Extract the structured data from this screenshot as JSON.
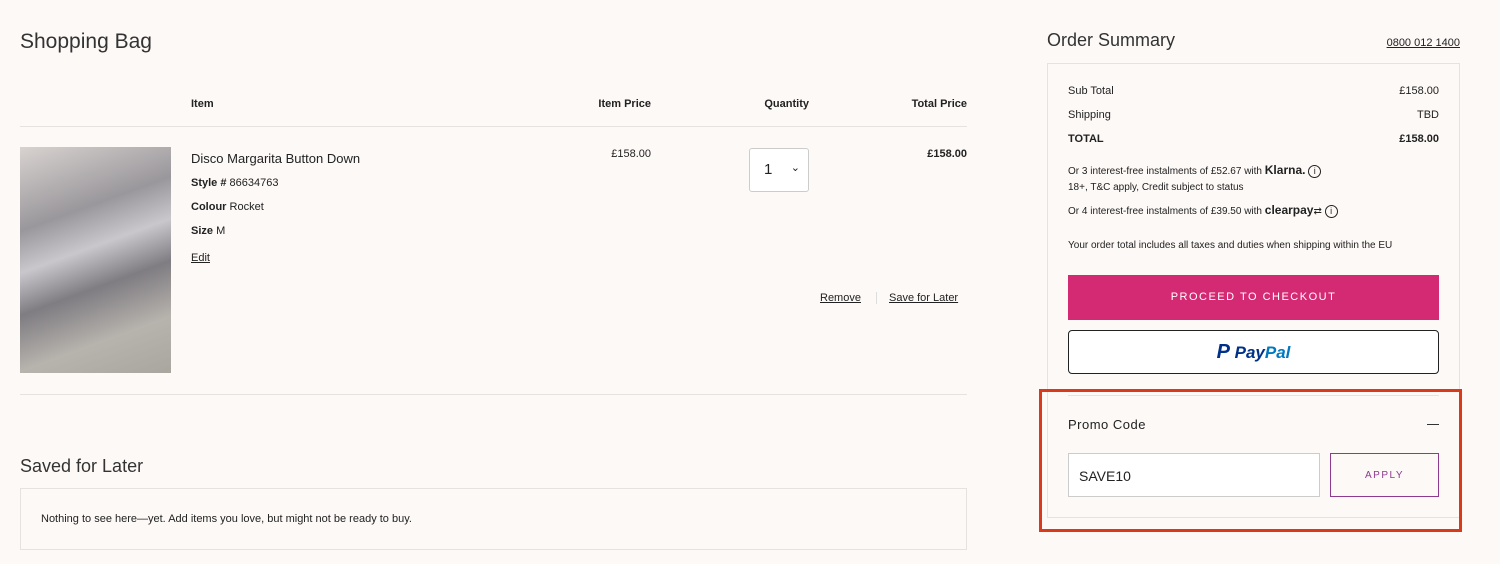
{
  "bag": {
    "title": "Shopping Bag",
    "headers": {
      "item": "Item",
      "item_price": "Item Price",
      "quantity": "Quantity",
      "total_price": "Total Price"
    },
    "item": {
      "name": "Disco Margarita Button Down",
      "style_label": "Style #",
      "style": "86634763",
      "colour_label": "Colour",
      "colour": "Rocket",
      "size_label": "Size",
      "size": "M",
      "edit": "Edit",
      "price": "£158.00",
      "quantity": "1",
      "total": "£158.00",
      "remove": "Remove",
      "save_for_later": "Save for Later"
    }
  },
  "saved": {
    "title": "Saved for Later",
    "empty": "Nothing to see here—yet. Add items you love, but might not be ready to buy."
  },
  "summary": {
    "title": "Order Summary",
    "phone": "0800 012 1400",
    "subtotal_label": "Sub Total",
    "subtotal": "£158.00",
    "shipping_label": "Shipping",
    "shipping": "TBD",
    "total_label": "TOTAL",
    "total": "£158.00",
    "klarna_text": "Or 3 interest-free instalments of £52.67 with",
    "klarna_logo": "Klarna.",
    "klarna_terms": "18+, T&C apply, Credit subject to status",
    "clearpay_text": "Or 4 interest-free instalments of £39.50 with",
    "clearpay_logo": "clearpay",
    "tax_note": "Your order total includes all taxes and duties when shipping within the EU",
    "checkout": "PROCEED TO CHECKOUT",
    "paypal_pay": "Pay",
    "paypal_pal": "Pal",
    "promo_label": "Promo Code",
    "promo_value": "SAVE10",
    "apply": "APPLY",
    "checkout_color": "#d42a73",
    "highlight_color": "#d93a1c"
  }
}
